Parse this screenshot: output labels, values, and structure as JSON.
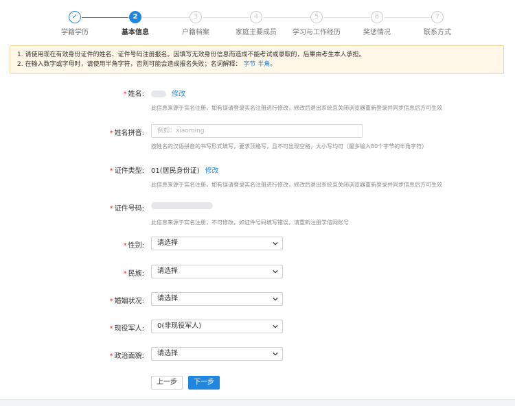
{
  "stepper": {
    "steps": [
      {
        "num": "✓",
        "label": "学籍学历",
        "state": "done"
      },
      {
        "num": "2",
        "label": "基本信息",
        "state": "active"
      },
      {
        "num": "3",
        "label": "户籍档案",
        "state": "todo"
      },
      {
        "num": "4",
        "label": "家庭主要成员",
        "state": "todo"
      },
      {
        "num": "5",
        "label": "学习与工作经历",
        "state": "todo"
      },
      {
        "num": "6",
        "label": "奖惩情况",
        "state": "todo"
      },
      {
        "num": "7",
        "label": "联系方式",
        "state": "todo"
      }
    ]
  },
  "notice": {
    "line1": "1. 请使用现在有效身份证件的姓名、证件号码注册报名。因填写无效身份信息而造成不能考试或录取的，后果由考生本人承担。",
    "line2_prefix": "2. 在输入数字或字母时，请使用半角字符，否则可能会造成报名失败；名词解释：",
    "line2_link1": "字节",
    "line2_link2": "半角",
    "line2_suffix": "。"
  },
  "form": {
    "name": {
      "label": "姓名:",
      "edit": "修改",
      "hint": "此信息来源于实名注册，如有误请登录实名注册进行修改，修改后退出系统且关闭浏览器重新登录并同步信息后方可生效"
    },
    "pinyin": {
      "label": "姓名拼音:",
      "placeholder": "例如：xiaoming",
      "hint": "按姓名的汉语拼音的书写形式填写，要求顶格写，且不可出现空格，大小写均可（最多输入80个字节的半角字符）"
    },
    "idtype": {
      "label": "证件类型:",
      "value": "01(居民身份证)",
      "edit": "修改",
      "hint": "此信息来源于实名注册，如有误请登录实名注册进行修改，修改后退出系统且关闭浏览器重新登录并同步信息后方可生效"
    },
    "idnum": {
      "label": "证件号码:",
      "hint": "此信息来源于实名注册，不可修改，如证件号码填写错误，请重新注册学信网账号"
    },
    "gender": {
      "label": "性别:",
      "value": "请选择"
    },
    "ethnic": {
      "label": "民族:",
      "value": "请选择"
    },
    "marital": {
      "label": "婚姻状况:",
      "value": "请选择"
    },
    "military": {
      "label": "现役军人:",
      "value": "0(非现役军人)"
    },
    "political": {
      "label": "政治面貌:",
      "value": "请选择"
    }
  },
  "buttons": {
    "prev": "上一步",
    "next": "下一步"
  },
  "colors": {
    "primary": "#1f87e0",
    "required": "#e0301e",
    "notice_bg": "#fff8e8",
    "notice_border": "#f7d8a1"
  }
}
